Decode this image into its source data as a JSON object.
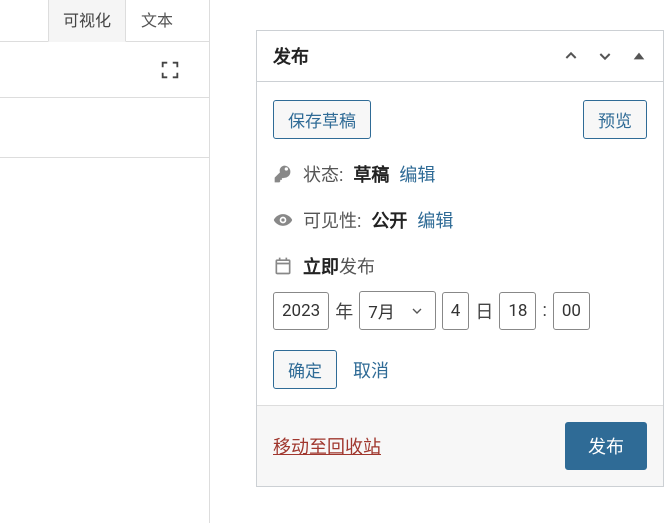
{
  "editor": {
    "tabs": {
      "visual": "可视化",
      "text": "文本"
    }
  },
  "publish": {
    "box_title": "发布",
    "save_draft": "保存草稿",
    "preview": "预览",
    "status": {
      "label": "状态:",
      "value": "草稿",
      "edit": "编辑"
    },
    "visibility": {
      "label": "可见性:",
      "value": "公开",
      "edit": "编辑"
    },
    "schedule": {
      "immediate": "立即",
      "publish_word": "发布",
      "year": "2023",
      "year_suffix": "年",
      "month": "7月",
      "day": "4",
      "day_suffix": "日",
      "hour": "18",
      "minute": "00",
      "ok": "确定",
      "cancel": "取消"
    },
    "trash": "移动至回收站",
    "submit": "发布"
  }
}
